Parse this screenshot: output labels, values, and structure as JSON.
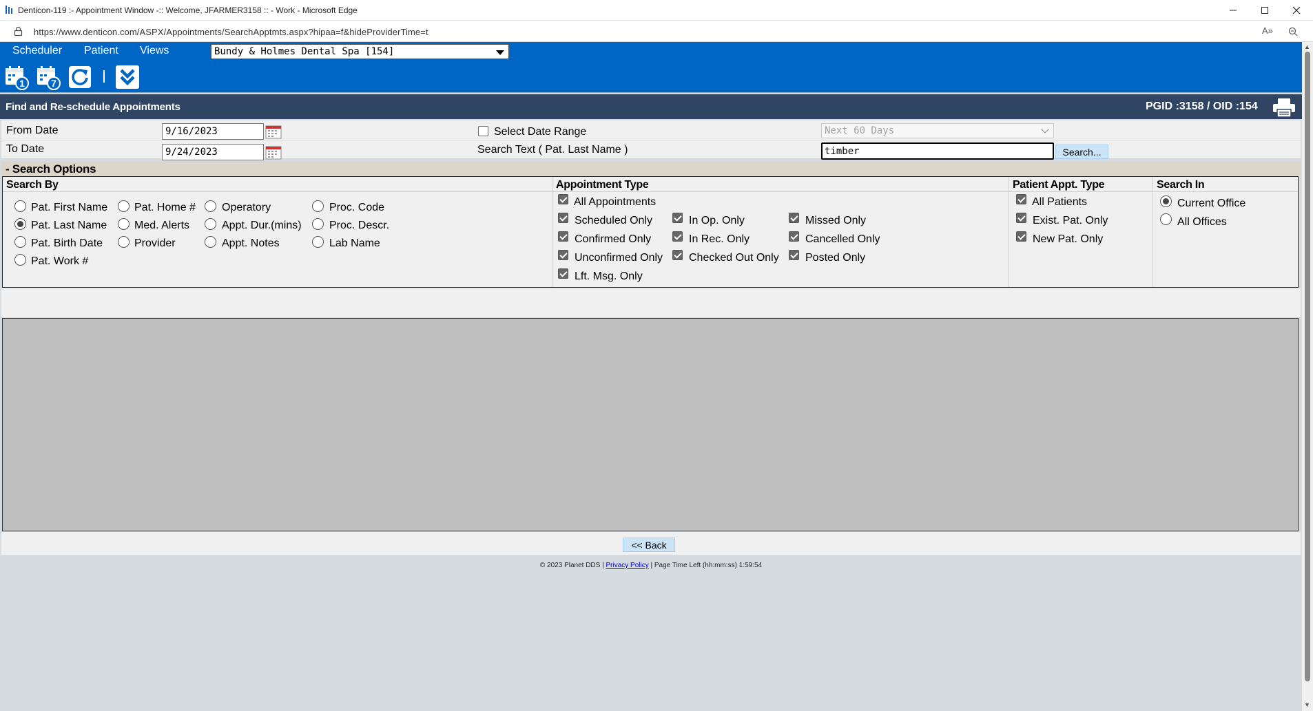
{
  "window": {
    "title": "Denticon-119 :- Appointment Window -:: Welcome, JFARMER3158 :: - Work - Microsoft Edge",
    "url": "https://www.denticon.com/ASPX/Appointments/SearchApptmts.aspx?hipaa=f&hideProviderTime=t"
  },
  "menu": {
    "items": [
      "Scheduler",
      "Patient",
      "Views"
    ],
    "office": "Bundy & Holmes Dental Spa [154]"
  },
  "toolbar": {
    "icons": [
      "calendar-day-icon",
      "calendar-week-icon",
      "refresh-icon",
      "expand-down-icon"
    ],
    "badge_day": "1",
    "badge_week": "7"
  },
  "heading": {
    "title": "Find and Re-schedule Appointments",
    "ids": "PGID :3158  /  OID :154"
  },
  "dates": {
    "from_label": "From Date",
    "from_value": "9/16/2023",
    "to_label": "To Date",
    "to_value": "9/24/2023",
    "select_range_label": "Select Date Range",
    "range_value": "Next 60 Days",
    "search_text_label": "Search Text ( Pat. Last Name )",
    "search_value": "timber",
    "search_button": "Search..."
  },
  "options": {
    "header": "- Search Options",
    "search_by": {
      "title": "Search By",
      "options": [
        "Pat. First Name",
        "Pat. Home #",
        "Operatory",
        "Proc. Code",
        "Pat. Last Name",
        "Med. Alerts",
        "Appt. Dur.(mins)",
        "Proc. Descr.",
        "Pat. Birth Date",
        "Provider",
        "Appt. Notes",
        "Lab Name",
        "Pat. Work #"
      ],
      "selected": "Pat. Last Name"
    },
    "appt_type": {
      "title": "Appointment Type",
      "options": [
        "All Appointments",
        "Scheduled Only",
        "In Op. Only",
        "Missed Only",
        "Confirmed Only",
        "In Rec. Only",
        "Cancelled Only",
        "Unconfirmed Only",
        "Checked Out Only",
        "Posted Only",
        "Lft. Msg. Only"
      ]
    },
    "patient_type": {
      "title": "Patient Appt. Type",
      "options": [
        "All Patients",
        "Exist. Pat. Only",
        "New Pat. Only"
      ]
    },
    "search_in": {
      "title": "Search In",
      "options": [
        "Current Office",
        "All Offices"
      ],
      "selected": "Current Office"
    }
  },
  "footer": {
    "back_button": "<< Back",
    "copyright": "© 2023 Planet DDS |",
    "privacy": "Privacy Policy",
    "time_left": "| Page Time Left (hh:mm:ss) 1:59:54"
  },
  "colors": {
    "menu_blue": "#0066c6",
    "heading_navy": "#2f4563",
    "button_blue": "#cce4f7"
  }
}
